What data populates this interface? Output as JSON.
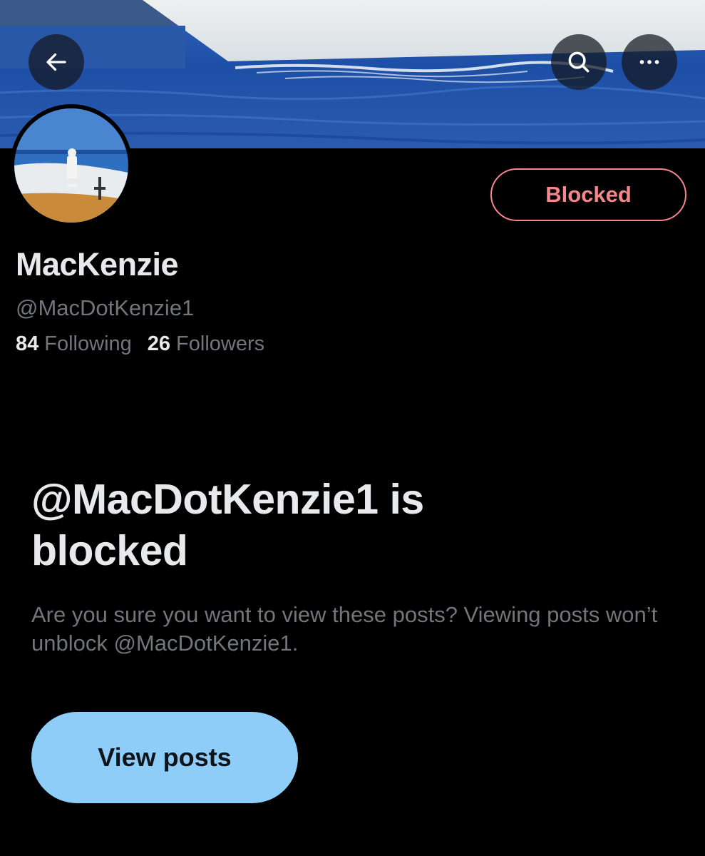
{
  "header": {
    "back_icon": "arrow-left-icon",
    "search_icon": "search-icon",
    "more_icon": "more-horizontal-icon"
  },
  "profile": {
    "display_name": "MacKenzie",
    "handle": "@MacDotKenzie1",
    "following_count": "84",
    "following_label": "Following",
    "followers_count": "26",
    "followers_label": "Followers",
    "blocked_button_label": "Blocked"
  },
  "blocked_notice": {
    "heading": "@MacDotKenzie1 is blocked",
    "subtext": "Are you sure you want to view these posts? Viewing posts won’t unblock @MacDotKenzie1.",
    "view_posts_label": "View posts"
  },
  "colors": {
    "background": "#000000",
    "blocked_accent": "#f4868c",
    "view_button": "#8ecdf8",
    "primary_text": "#e7e9ea",
    "secondary_text": "#71767b"
  }
}
